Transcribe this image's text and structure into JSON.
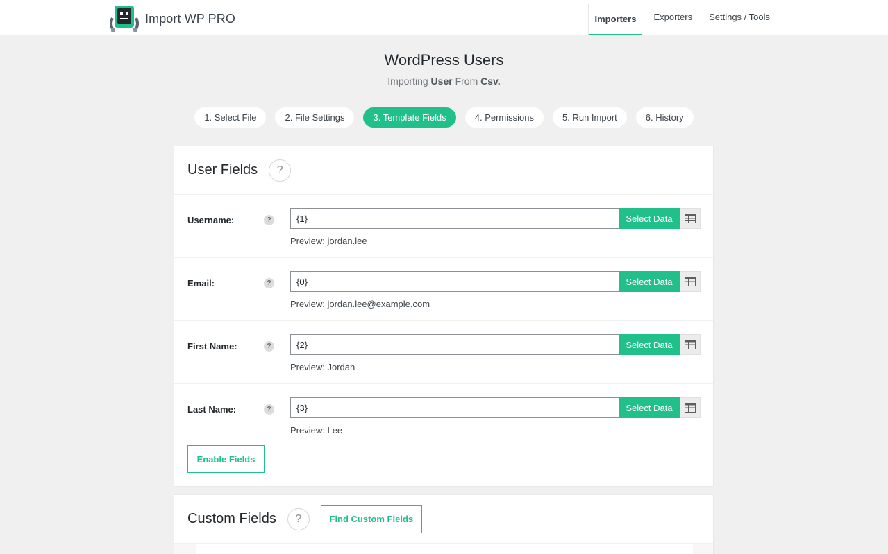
{
  "brand": {
    "name": "Import WP PRO",
    "logo_icon": "robot-logo-icon"
  },
  "nav": [
    {
      "label": "Importers",
      "active": true
    },
    {
      "label": "Exporters",
      "active": false
    },
    {
      "label": "Settings / Tools",
      "active": false
    }
  ],
  "page": {
    "title": "WordPress Users",
    "subtitle_prefix": "Importing",
    "subtitle_entity": "User",
    "subtitle_mid": "From",
    "subtitle_source": "Csv."
  },
  "steps": [
    {
      "label": "1. Select File",
      "active": false
    },
    {
      "label": "2. File Settings",
      "active": false
    },
    {
      "label": "3. Template Fields",
      "active": true
    },
    {
      "label": "4. Permissions",
      "active": false
    },
    {
      "label": "5. Run Import",
      "active": false
    },
    {
      "label": "6. History",
      "active": false
    }
  ],
  "user_fields": {
    "title": "User Fields",
    "help": "?",
    "fields": [
      {
        "label": "Username:",
        "value": "{1}",
        "preview": "Preview: jordan.lee",
        "button": "Select Data",
        "help": "?"
      },
      {
        "label": "Email:",
        "value": "{0}",
        "preview": "Preview: jordan.lee@example.com",
        "button": "Select Data",
        "help": "?"
      },
      {
        "label": "First Name:",
        "value": "{2}",
        "preview": "Preview: Jordan",
        "button": "Select Data",
        "help": "?"
      },
      {
        "label": "Last Name:",
        "value": "{3}",
        "preview": "Preview: Lee",
        "button": "Select Data",
        "help": "?"
      }
    ],
    "enable_button": "Enable Fields"
  },
  "custom_fields": {
    "title": "Custom Fields",
    "help": "?",
    "find_button": "Find Custom Fields"
  },
  "colors": {
    "accent": "#21c08b",
    "background": "#f0f0f0"
  }
}
